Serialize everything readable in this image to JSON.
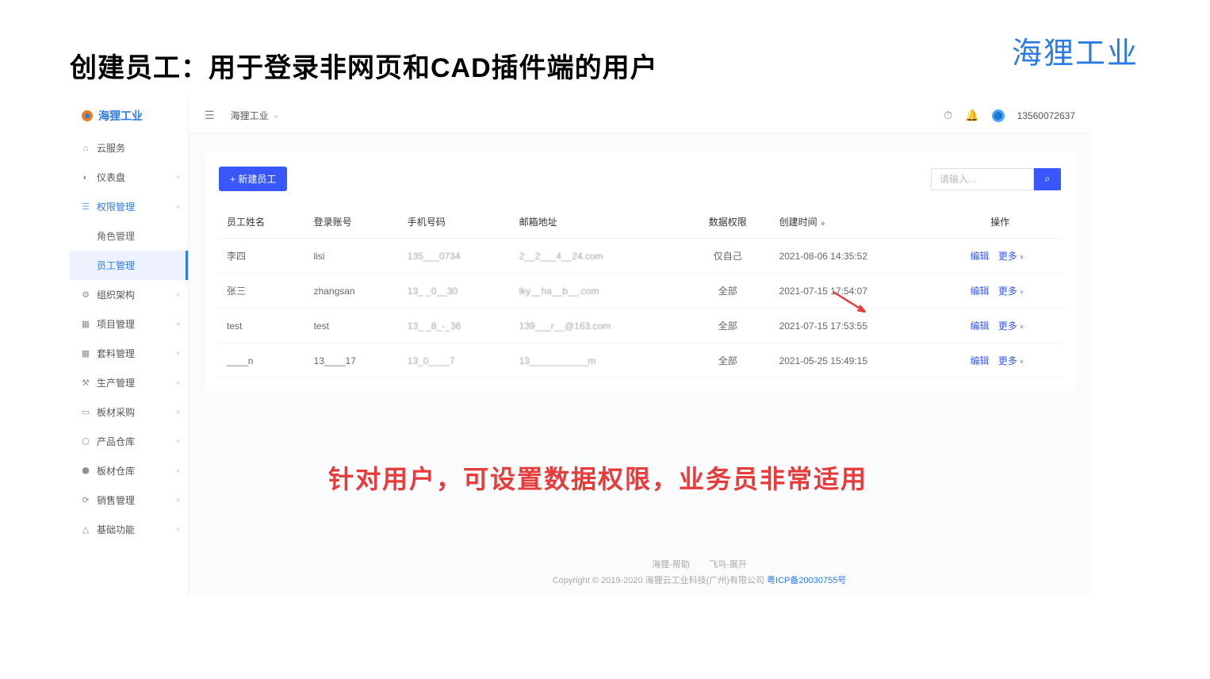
{
  "brand": "海狸工业",
  "page_title": "创建员工：用于登录非网页和CAD插件端的用户",
  "sidebar": {
    "logo_text": "海狸工业",
    "items": [
      {
        "label": "云服务",
        "icon": "⌂",
        "chevron": ""
      },
      {
        "label": "仪表盘",
        "icon": "◐",
        "chevron": "˅"
      },
      {
        "label": "权限管理",
        "icon": "☰",
        "chevron": "˄",
        "active": true
      },
      {
        "label": "角色管理",
        "sub": true
      },
      {
        "label": "员工管理",
        "sub": true,
        "selected": true
      },
      {
        "label": "组织架构",
        "icon": "⚙",
        "chevron": "˅"
      },
      {
        "label": "项目管理",
        "icon": "▦",
        "chevron": "˅"
      },
      {
        "label": "套料管理",
        "icon": "▦",
        "chevron": "˅"
      },
      {
        "label": "生产管理",
        "icon": "⚒",
        "chevron": "˅"
      },
      {
        "label": "板材采购",
        "icon": "▭",
        "chevron": "˅"
      },
      {
        "label": "产品仓库",
        "icon": "⬡",
        "chevron": "˅"
      },
      {
        "label": "板材仓库",
        "icon": "⬢",
        "chevron": "˅"
      },
      {
        "label": "销售管理",
        "icon": "⟳",
        "chevron": "˅"
      },
      {
        "label": "基础功能",
        "icon": "△",
        "chevron": "˅"
      }
    ]
  },
  "topbar": {
    "org_name": "海狸工业",
    "phone": "13560072637"
  },
  "buttons": {
    "new_employee": "+ 新建员工"
  },
  "search": {
    "placeholder": "请输入..."
  },
  "table": {
    "headers": {
      "name": "员工姓名",
      "account": "登录账号",
      "phone": "手机号码",
      "email": "邮箱地址",
      "perm": "数据权限",
      "created": "创建时间",
      "action": "操作"
    },
    "action_edit": "编辑",
    "action_more": "更多",
    "rows": [
      {
        "name": "李四",
        "account": "lisi",
        "phone": "135___0734",
        "email": "2__2___4__24.com",
        "perm": "仅自己",
        "created": "2021-08-06 14:35:52"
      },
      {
        "name": "张三",
        "account": "zhangsan",
        "phone": "13_ _0__30",
        "email": "lky__ha__b__.com",
        "perm": "全部",
        "created": "2021-07-15 17:54:07"
      },
      {
        "name": "test",
        "account": "test",
        "phone": "13_ _8_-_36",
        "email": "139___r__@163.com",
        "perm": "全部",
        "created": "2021-07-15 17:53:55"
      },
      {
        "name": "____n",
        "account": "13____17",
        "phone": "13_0____7",
        "email": "13___________m",
        "perm": "全部",
        "created": "2021-05-25 15:49:15"
      }
    ]
  },
  "callout_text": "针对用户，可设置数据权限，业务员非常适用",
  "footer": {
    "links": "海狸-帮助        飞鸟-展开",
    "copyright": "Copyright © 2019-2020 海狸云工业科技(广州)有限公司 ",
    "icp": "粤ICP备20030755号"
  }
}
